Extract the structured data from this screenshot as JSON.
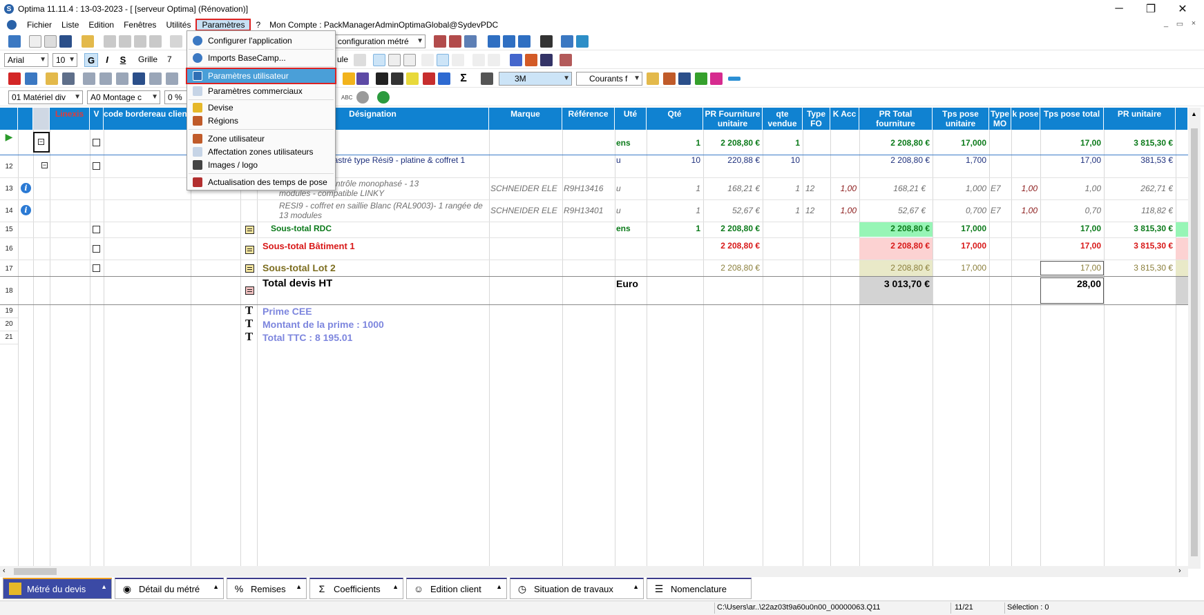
{
  "window": {
    "title": "Optima 11.11.4 : 13-03-2023 - [ [serveur Optima] (Rénovation)]",
    "controls": [
      "─",
      "❐",
      "✕"
    ]
  },
  "menubar": {
    "items": [
      "Fichier",
      "Liste",
      "Edition",
      "Fenêtres",
      "Utilités",
      "Paramètres",
      "?"
    ],
    "account": "Mon Compte : PackManagerAdminOptimaGlobal@SydevPDC"
  },
  "toolbar": {
    "configuration_select": "configuration métré",
    "font_select": "Arial",
    "font_size": "10",
    "bold_label": "G",
    "italic_label": "I",
    "strike_label": "S",
    "grille_label": "Grille",
    "grille_value": "7",
    "formule_label": "ule",
    "zone_select": "3M",
    "courants_select": "Courants f",
    "materiel_select": "01  Matériel div",
    "montage_select": "A0  Montage c",
    "percent_select": "0 %",
    "abc_label": "ABC"
  },
  "dropdown": {
    "items": [
      {
        "label": "Configurer l'application",
        "icon": "gear-icon",
        "color": "#3b78c2"
      },
      {
        "label": "Imports BaseCamp...",
        "icon": "import-icon",
        "color": "#3b78c2"
      },
      {
        "label": "Paramètres utilisateur",
        "icon": "user-settings-icon",
        "color": "#2f6fb5",
        "highlighted": true
      },
      {
        "label": "Paramètres commerciaux",
        "icon": "list-icon",
        "color": "#6c8fb8"
      },
      {
        "label": "Devise",
        "icon": "currency-icon",
        "color": "#d9a300"
      },
      {
        "label": "Régions",
        "icon": "users-icon",
        "color": "#c05b2a"
      },
      {
        "label": "Zone utilisateur",
        "icon": "users-icon",
        "color": "#c05b2a"
      },
      {
        "label": "Affectation zones utilisateurs",
        "icon": "list-icon",
        "color": "#6c8fb8"
      },
      {
        "label": "Images / logo",
        "icon": "camera-icon",
        "color": "#444444"
      },
      {
        "label": "Actualisation des temps de pose",
        "icon": "refresh-icon",
        "color": "#b22f2f"
      }
    ]
  },
  "grid": {
    "columns": [
      "",
      "",
      "Linexis",
      "V",
      "code bordereau client",
      "",
      "",
      "Désignation",
      "Marque",
      "Référence",
      "Uté",
      "Qté",
      "PR Fourniture unitaire",
      "qte vendue",
      "Type FO",
      "K Acc",
      "PR Total fourniture",
      "Tps pose unitaire",
      "Type MO",
      "k pose",
      "Tps pose total",
      "PR unitaire"
    ],
    "rows": [
      {
        "num": "",
        "designation": "",
        "unit": "ens",
        "qty": "1",
        "pr_unit": "2 208,80 €",
        "qte_vendue": "1",
        "type_fo": "",
        "k_acc": "",
        "pr_total": "2 208,80 €",
        "tps_unit": "17,000",
        "type_mo": "",
        "k_pose": "",
        "tps_total": "17,00",
        "pr_unitaire": "3 815,30 €",
        "marque": "",
        "reference": ""
      },
      {
        "num": "12",
        "designation": "ncastré type Rési9 - platine & coffret 1",
        "unit": "u",
        "qty": "10",
        "pr_unit": "220,88 €",
        "qte_vendue": "10",
        "type_fo": "",
        "k_acc": "",
        "pr_total": "2 208,80 €",
        "tps_unit": "1,700",
        "type_mo": "",
        "k_pose": "",
        "tps_total": "17,00",
        "pr_unitaire": "381,53 €",
        "marque": "",
        "reference": ""
      },
      {
        "num": "13",
        "designation": "au de contrôle monophasé - 13",
        "designation2": "modules - compatible LINKY",
        "unit": "u",
        "qty": "1",
        "pr_unit": "168,21 €",
        "qte_vendue": "1",
        "type_fo": "12",
        "k_acc": "1,00",
        "pr_total": "168,21 €",
        "tps_unit": "1,000",
        "type_mo": "E7",
        "k_pose": "1,00",
        "tps_total": "1,00",
        "pr_unitaire": "262,71 €",
        "marque": "SCHNEIDER ELE",
        "reference": "R9H13416"
      },
      {
        "num": "14",
        "designation": "RESI9 - coffret en saillie Blanc (RAL9003)- 1 rangée de",
        "designation2": "13 modules",
        "unit": "u",
        "qty": "1",
        "pr_unit": "52,67 €",
        "qte_vendue": "1",
        "type_fo": "12",
        "k_acc": "1,00",
        "pr_total": "52,67 €",
        "tps_unit": "0,700",
        "type_mo": "E7",
        "k_pose": "1,00",
        "tps_total": "0,70",
        "pr_unitaire": "118,82 €",
        "marque": "SCHNEIDER ELE",
        "reference": "R9H13401"
      },
      {
        "num": "15",
        "designation": "Sous-total RDC",
        "unit": "ens",
        "qty": "1",
        "pr_unit": "2 208,80 €",
        "pr_total": "2 208,80 €",
        "tps_unit": "17,000",
        "tps_total": "17,00",
        "pr_unitaire": "3 815,30 €"
      },
      {
        "num": "16",
        "designation": "Sous-total Bâtiment 1",
        "pr_unit": "2 208,80 €",
        "pr_total": "2 208,80 €",
        "tps_unit": "17,000",
        "tps_total": "17,00",
        "pr_unitaire": "3 815,30 €"
      },
      {
        "num": "17",
        "designation": "Sous-total Lot 2",
        "pr_unit": "2 208,80 €",
        "pr_total": "2 208,80 €",
        "tps_unit": "17,000",
        "tps_total": "17,00",
        "pr_unitaire": "3 815,30 €"
      },
      {
        "num": "18",
        "designation": "Total devis HT",
        "unit": "Euro",
        "pr_total": "3 013,70 €",
        "tps_total": "28,00"
      },
      {
        "num": "19",
        "designation": "Prime CEE"
      },
      {
        "num": "20",
        "designation": "Montant  de la prime : 1000"
      },
      {
        "num": "21",
        "designation": "Total TTC : 8 195.01"
      }
    ]
  },
  "tabs": [
    {
      "label": "Métré du devis",
      "icon": "document-icon",
      "active": true
    },
    {
      "label": "Détail du métré",
      "icon": "eye-icon"
    },
    {
      "label": "Remises",
      "icon": "percent-icon"
    },
    {
      "label": "Coefficients",
      "icon": "sigma-icon"
    },
    {
      "label": "Edition client",
      "icon": "user-icon"
    },
    {
      "label": "Situation de travaux",
      "icon": "clock-icon"
    },
    {
      "label": "Nomenclature",
      "icon": "list-icon"
    }
  ],
  "status": {
    "path": "C:\\Users\\ar..\\22az03t9a60u0n00_00000063.Q11",
    "position": "11/21",
    "selection": "Sélection : 0"
  }
}
